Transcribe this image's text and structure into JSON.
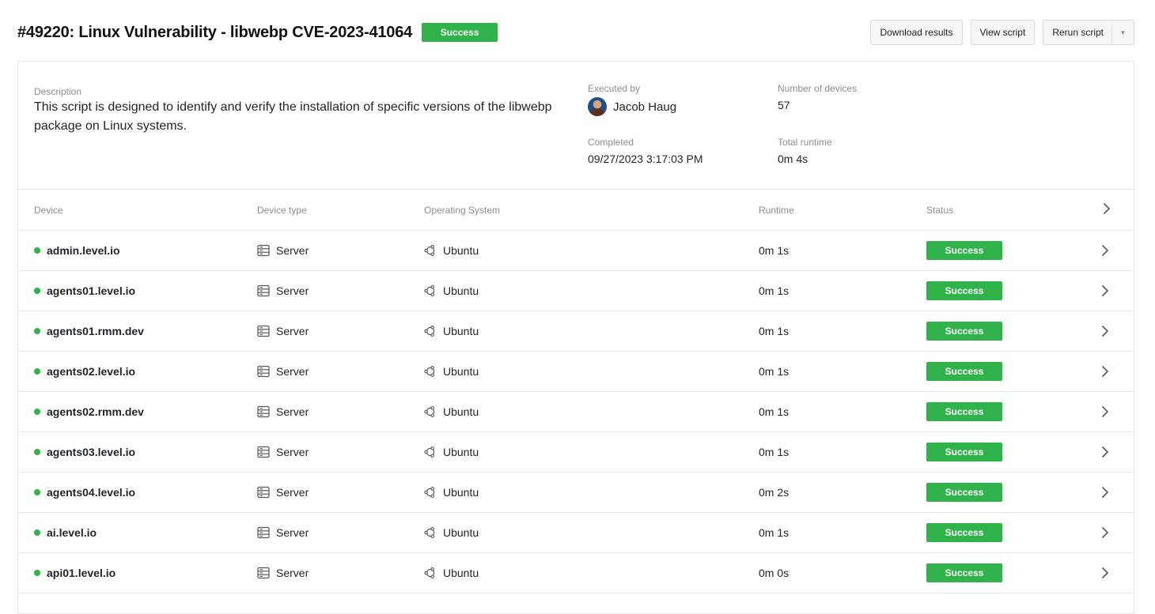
{
  "header": {
    "title": "#49220: Linux Vulnerability - libwebp CVE-2023-41064",
    "status": "Success",
    "buttons": {
      "download": "Download results",
      "view": "View script",
      "rerun": "Rerun script"
    }
  },
  "summary": {
    "description_label": "Description",
    "description": "This script is designed to identify and verify the installation of specific versions of the libwebp package on Linux systems.",
    "executed_by_label": "Executed by",
    "executed_by": "Jacob Haug",
    "completed_label": "Completed",
    "completed": "09/27/2023 3:17:03 PM",
    "devices_label": "Number of devices",
    "devices": "57",
    "runtime_label": "Total runtime",
    "runtime": "0m 4s"
  },
  "table": {
    "columns": {
      "device": "Device",
      "type": "Device type",
      "os": "Operating System",
      "runtime": "Runtime",
      "status": "Status"
    },
    "rows": [
      {
        "device": "admin.level.io",
        "type": "Server",
        "os": "Ubuntu",
        "runtime": "0m 1s",
        "status": "Success"
      },
      {
        "device": "agents01.level.io",
        "type": "Server",
        "os": "Ubuntu",
        "runtime": "0m 1s",
        "status": "Success"
      },
      {
        "device": "agents01.rmm.dev",
        "type": "Server",
        "os": "Ubuntu",
        "runtime": "0m 1s",
        "status": "Success"
      },
      {
        "device": "agents02.level.io",
        "type": "Server",
        "os": "Ubuntu",
        "runtime": "0m 1s",
        "status": "Success"
      },
      {
        "device": "agents02.rmm.dev",
        "type": "Server",
        "os": "Ubuntu",
        "runtime": "0m 1s",
        "status": "Success"
      },
      {
        "device": "agents03.level.io",
        "type": "Server",
        "os": "Ubuntu",
        "runtime": "0m 1s",
        "status": "Success"
      },
      {
        "device": "agents04.level.io",
        "type": "Server",
        "os": "Ubuntu",
        "runtime": "0m 2s",
        "status": "Success"
      },
      {
        "device": "ai.level.io",
        "type": "Server",
        "os": "Ubuntu",
        "runtime": "0m 1s",
        "status": "Success"
      },
      {
        "device": "api01.level.io",
        "type": "Server",
        "os": "Ubuntu",
        "runtime": "0m 0s",
        "status": "Success"
      }
    ]
  },
  "icons": {
    "type": "server-icon",
    "os": "ubuntu-icon",
    "row_action": "chevron-right-icon",
    "online": "status-dot-icon"
  },
  "colors": {
    "success": "#2fb34a",
    "online_dot": "#2fb34a",
    "border": "#e5e7ea",
    "muted_label": "#8a8f96"
  }
}
